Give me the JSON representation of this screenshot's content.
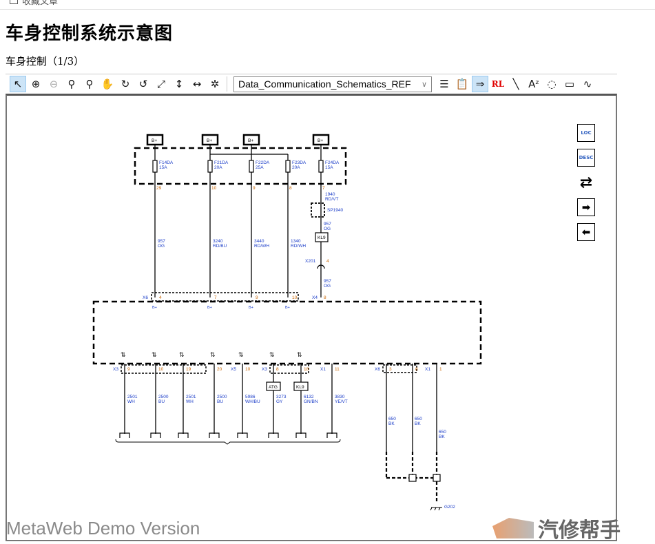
{
  "topbar": {
    "checkbox_label": "收藏文章"
  },
  "title": "车身控制系统示意图",
  "subtitle": "车身控制（1/3）",
  "toolbar": {
    "tools": [
      {
        "name": "pointer",
        "glyph": "↖",
        "active": true
      },
      {
        "name": "zoom-in",
        "glyph": "⊕"
      },
      {
        "name": "zoom-out",
        "glyph": "⊖",
        "disabled": true
      },
      {
        "name": "zoom",
        "glyph": "⚲"
      },
      {
        "name": "zoom-area",
        "glyph": "⚲"
      },
      {
        "name": "pan-hand",
        "glyph": "✋",
        "disabled": true
      },
      {
        "name": "rotate-cw",
        "glyph": "↻"
      },
      {
        "name": "rotate-ccw",
        "glyph": "↺"
      },
      {
        "name": "fit-page",
        "glyph": "⤢"
      },
      {
        "name": "fit-height",
        "glyph": "↕"
      },
      {
        "name": "fit-width",
        "glyph": "↔"
      },
      {
        "name": "highlight",
        "glyph": "✲"
      }
    ],
    "dropdown_value": "Data_Communication_Schematics_REF",
    "tools_right": [
      {
        "name": "list",
        "glyph": "☰"
      },
      {
        "name": "properties",
        "glyph": "📋"
      },
      {
        "name": "follow-wire",
        "glyph": "⇒",
        "active": true
      },
      {
        "name": "reference-label",
        "glyph": "RL",
        "color": "#e00000"
      },
      {
        "name": "line",
        "glyph": "╲"
      },
      {
        "name": "text",
        "glyph": "Aᶻ"
      },
      {
        "name": "lasso",
        "glyph": "◌"
      },
      {
        "name": "rectangle",
        "glyph": "▭"
      },
      {
        "name": "freehand",
        "glyph": "∿"
      }
    ]
  },
  "side_buttons": [
    {
      "name": "loc",
      "text": "LOC"
    },
    {
      "name": "desc",
      "text": "DESC"
    },
    {
      "name": "swap",
      "text": "⇄"
    },
    {
      "name": "next",
      "text": "➡"
    },
    {
      "name": "prev",
      "text": "⬅"
    }
  ],
  "schematic": {
    "supply_label": "B+",
    "fuses": [
      {
        "id": "F14DA",
        "rating": "15A",
        "pin": "29",
        "wire": "957",
        "color": "OG",
        "in_pin": "4",
        "b_plus": true
      },
      {
        "id": "F21DA",
        "rating": "20A",
        "pin": "10",
        "wire": "3240",
        "color": "RD/BU",
        "in_pin": "7",
        "b_plus": true
      },
      {
        "id": "F22DA",
        "rating": "25A",
        "pin": "9",
        "wire": "3440",
        "color": "RD/WH",
        "in_pin": "9",
        "b_plus": true
      },
      {
        "id": "F23DA",
        "rating": "20A",
        "pin": "8",
        "wire": "1340",
        "color": "RD/WH",
        "in_pin": "10",
        "b_plus": false
      },
      {
        "id": "F24DA",
        "rating": "15A",
        "pin": "7",
        "wire": "1940",
        "color": "RD/VT",
        "in_pin": "8",
        "b_plus": true
      }
    ],
    "input_connectors": [
      "X6",
      "X4"
    ],
    "module_pin_label": "B+",
    "splice": "SP1940",
    "kl9_wire": {
      "wire": "957",
      "color": "OG"
    },
    "kl9_label": "KL9",
    "x201": {
      "id": "X201",
      "pin": "4"
    },
    "x4_wire": {
      "wire": "957",
      "color": "OG"
    },
    "bottom": [
      {
        "conn": "X3",
        "pin": "9",
        "wire": "2501",
        "color": "WH"
      },
      {
        "conn": "",
        "pin": "10",
        "wire": "2500",
        "color": "BU"
      },
      {
        "conn": "",
        "pin": "19",
        "wire": "2501",
        "color": "WH"
      },
      {
        "conn": "",
        "pin": "20",
        "wire": "2500",
        "color": "BU"
      },
      {
        "conn": "X5",
        "pin": "10",
        "wire": "5986",
        "color": "WH/BU"
      },
      {
        "conn": "X3",
        "pin": "8",
        "wire": "3273",
        "color": "GY",
        "tag": "ATG"
      },
      {
        "conn": "",
        "pin": "18",
        "wire": "6132",
        "color": "GN/BN",
        "tag": "KL9"
      },
      {
        "conn": "X1",
        "pin": "11",
        "wire": "3830",
        "color": "YE/VT"
      }
    ],
    "grounds": [
      {
        "conn": "X6",
        "pin": "3",
        "wire": "650",
        "color": "BK"
      },
      {
        "conn": "",
        "pin": "8",
        "wire": "650",
        "color": "BK"
      },
      {
        "conn": "X1",
        "pin": "1",
        "wire": "650",
        "color": "BK"
      }
    ],
    "ground_id": "G202",
    "wire_label_color": "#1a3cc8",
    "pin_label_color": "#c86400"
  },
  "watermark": "MetaWeb Demo Version",
  "logo_text": "汽修帮手"
}
